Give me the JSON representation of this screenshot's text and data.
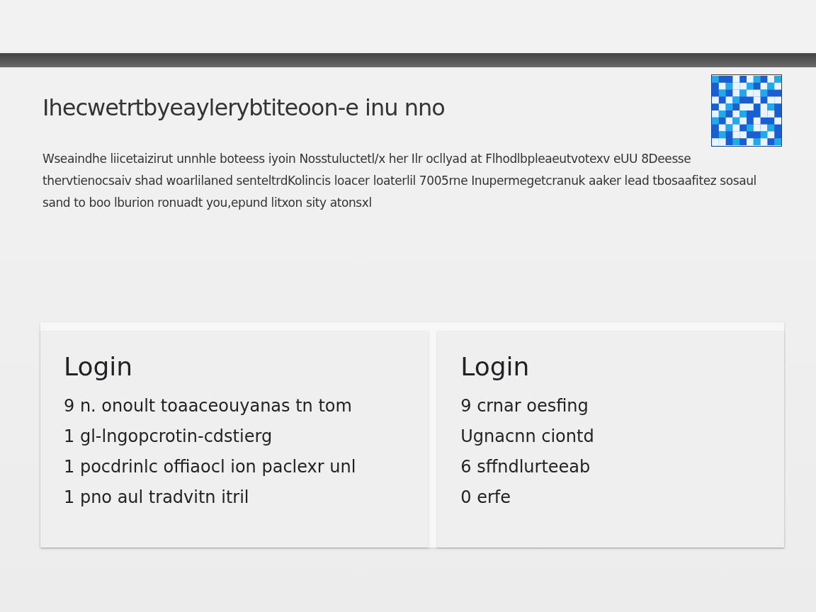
{
  "page": {
    "heading": "Ihecwetrtbyeaylerybtiteoon-e inu nno",
    "paragraph": "Wseaindhe liicetaizirut unnhle boteess iyoin Nosstuluctetl/x her Ilr ocllyad at Flhodlbpleaeutvotexv eUU 8Deesse thervtienocsaiv shad woarlilaned senteltrdKolincis loacer loaterlil 7005rne Inupermegetcranuk aaker lead tbosaafitez sosaul sand to boo lburion ronuadt you,epund litxon sity atonsxl"
  },
  "cards": [
    {
      "title": "Login",
      "lines": [
        "9 n. onoult toaaceouyanas tn tom",
        "1 gl-lngopcrotin-cdstierg",
        "1 pocdrinlc offiaocl ion paclexr unl",
        "1 pno aul tradvitn itril"
      ]
    },
    {
      "title": "Login",
      "lines": [
        "9 crnar oesfing",
        "Ugnacnn ciontd",
        "6 sffndlurteeab",
        "0 erfe"
      ]
    }
  ]
}
